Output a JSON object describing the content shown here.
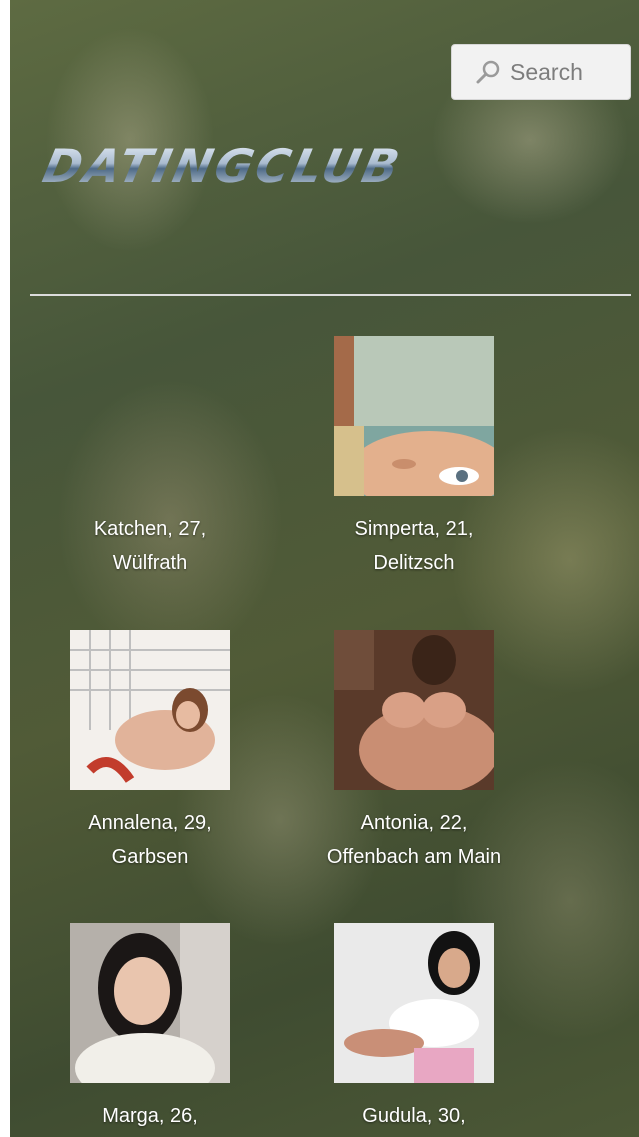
{
  "search": {
    "label": "Search"
  },
  "logo": {
    "text": "DATINGCLUB"
  },
  "profiles": [
    {
      "name": "Katchen, 27,",
      "city": "Wülfrath"
    },
    {
      "name": "Simperta, 21,",
      "city": "Delitzsch"
    },
    {
      "name": "Annalena, 29,",
      "city": "Garbsen"
    },
    {
      "name": "Antonia, 22,",
      "city": "Offenbach am Main"
    },
    {
      "name": "Marga, 26,",
      "city": ""
    },
    {
      "name": "Gudula, 30,",
      "city": ""
    }
  ]
}
